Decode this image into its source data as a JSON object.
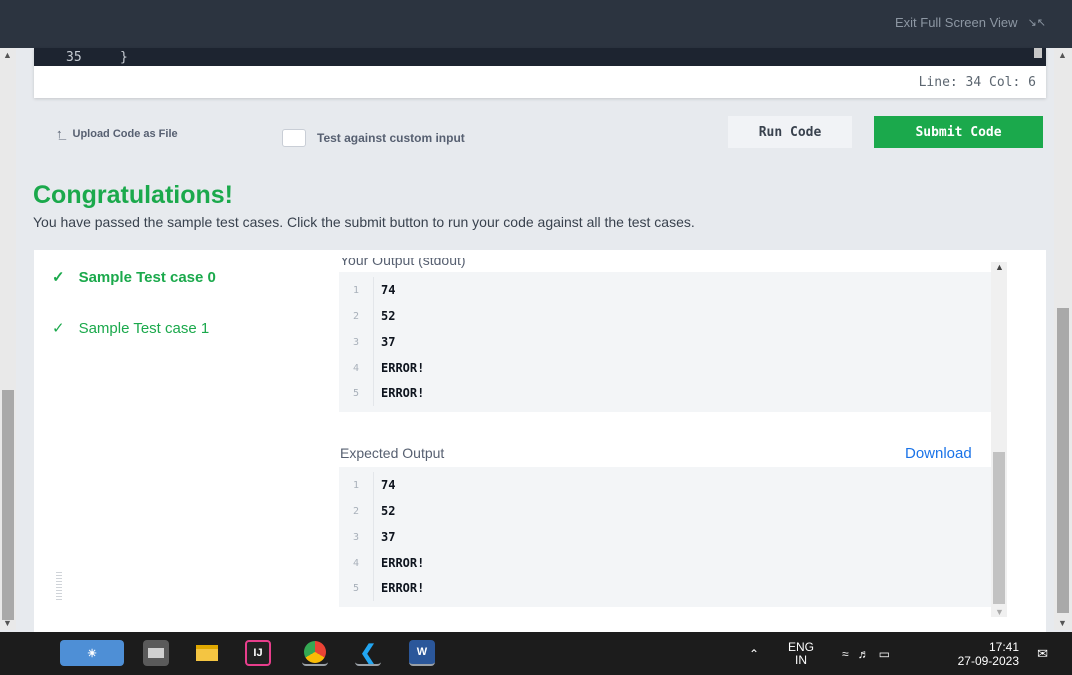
{
  "topbar": {
    "exit_label": "Exit Full Screen View",
    "exit_icon": "compress-arrows-icon"
  },
  "editor": {
    "line_number": "35",
    "line_text": "}",
    "status": "Line: 34  Col: 6"
  },
  "toolbar": {
    "upload_label": "Upload Code as File",
    "custom_input_label": "Test against custom input",
    "custom_input_checked": false,
    "run_label": "Run Code",
    "submit_label": "Submit Code"
  },
  "result": {
    "title": "Congratulations!",
    "message": "You have passed the sample test cases. Click the submit button to run your code against all the test cases."
  },
  "test_cases": [
    {
      "label": "Sample Test case 0",
      "passed": true,
      "active": true
    },
    {
      "label": "Sample Test case 1",
      "passed": true,
      "active": false
    }
  ],
  "your_output": {
    "label": "Your Output (stdout)",
    "lines": [
      {
        "num": "1",
        "text": "74"
      },
      {
        "num": "2",
        "text": "52"
      },
      {
        "num": "3",
        "text": "37"
      },
      {
        "num": "4",
        "text": "ERROR!"
      },
      {
        "num": "5",
        "text": "ERROR!"
      }
    ]
  },
  "expected_output": {
    "label": "Expected Output",
    "download_label": "Download",
    "lines": [
      {
        "num": "1",
        "text": "74"
      },
      {
        "num": "2",
        "text": "52"
      },
      {
        "num": "3",
        "text": "37"
      },
      {
        "num": "4",
        "text": "ERROR!"
      },
      {
        "num": "5",
        "text": "ERROR!"
      }
    ]
  },
  "taskbar": {
    "apps": [
      {
        "name": "widgets-icon",
        "color": "#4e8fd6"
      },
      {
        "name": "task-view-icon",
        "color": "#c9c9c9"
      },
      {
        "name": "file-explorer-icon",
        "color": "#f4c542"
      },
      {
        "name": "intellij-icon",
        "color": "#e83e8c",
        "text": "IJ"
      },
      {
        "name": "chrome-icon",
        "color": "#fbbc05"
      },
      {
        "name": "vscode-icon",
        "color": "#22a6f2"
      },
      {
        "name": "word-icon",
        "color": "#2b579a",
        "text": "W"
      }
    ],
    "language": "ENG",
    "region": "IN",
    "time": "17:41",
    "date": "27-09-2023"
  },
  "colors": {
    "accent_green": "#1ba94c",
    "link_blue": "#1a73e8",
    "topbar": "#2c3440"
  }
}
